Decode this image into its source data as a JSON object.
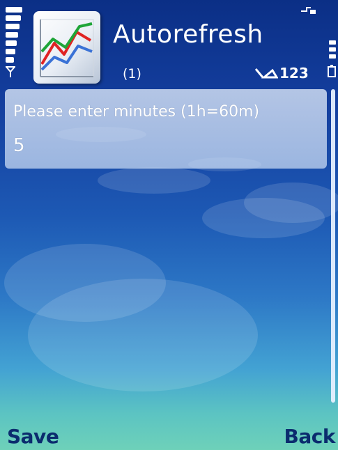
{
  "header": {
    "title": "Autorefresh",
    "subtitle": "(1)",
    "input_mode": "123",
    "app_icon": "chart-app-icon"
  },
  "query": {
    "prompt": "Please enter minutes (1h=60m)",
    "value": "5"
  },
  "softkeys": {
    "left": "Save",
    "right": "Back"
  },
  "colors": {
    "background_top": "#0b2f86",
    "background_bottom": "#6ed1b9",
    "softkey_text": "#0b2c6e",
    "panel": "#dce9f8"
  }
}
